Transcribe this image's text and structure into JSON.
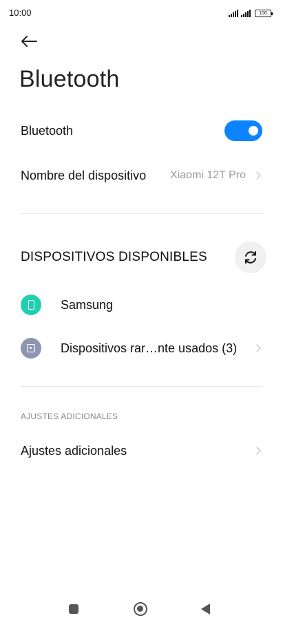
{
  "status_bar": {
    "time": "10:00",
    "battery": "100"
  },
  "header": {
    "title": "Bluetooth"
  },
  "bluetooth_toggle": {
    "label": "Bluetooth",
    "state": "on",
    "accent_color": "#0d84ff"
  },
  "device_name": {
    "label": "Nombre del dispositivo",
    "value": "Xiaomi 12T Pro"
  },
  "available_devices": {
    "heading": "DISPOSITIVOS DISPONIBLES",
    "items": [
      {
        "label": "Samsung",
        "icon": "phone-icon",
        "icon_color": "#1fd0b0"
      },
      {
        "label": "Dispositivos rar…nte usados (3)",
        "icon": "device-icon",
        "icon_color": "#8f96b2"
      }
    ]
  },
  "additional_settings": {
    "heading": "AJUSTES ADICIONALES",
    "item_label": "Ajustes adicionales"
  },
  "nav_bar": {
    "icons": [
      "recents-icon",
      "home-icon",
      "back-icon"
    ]
  }
}
